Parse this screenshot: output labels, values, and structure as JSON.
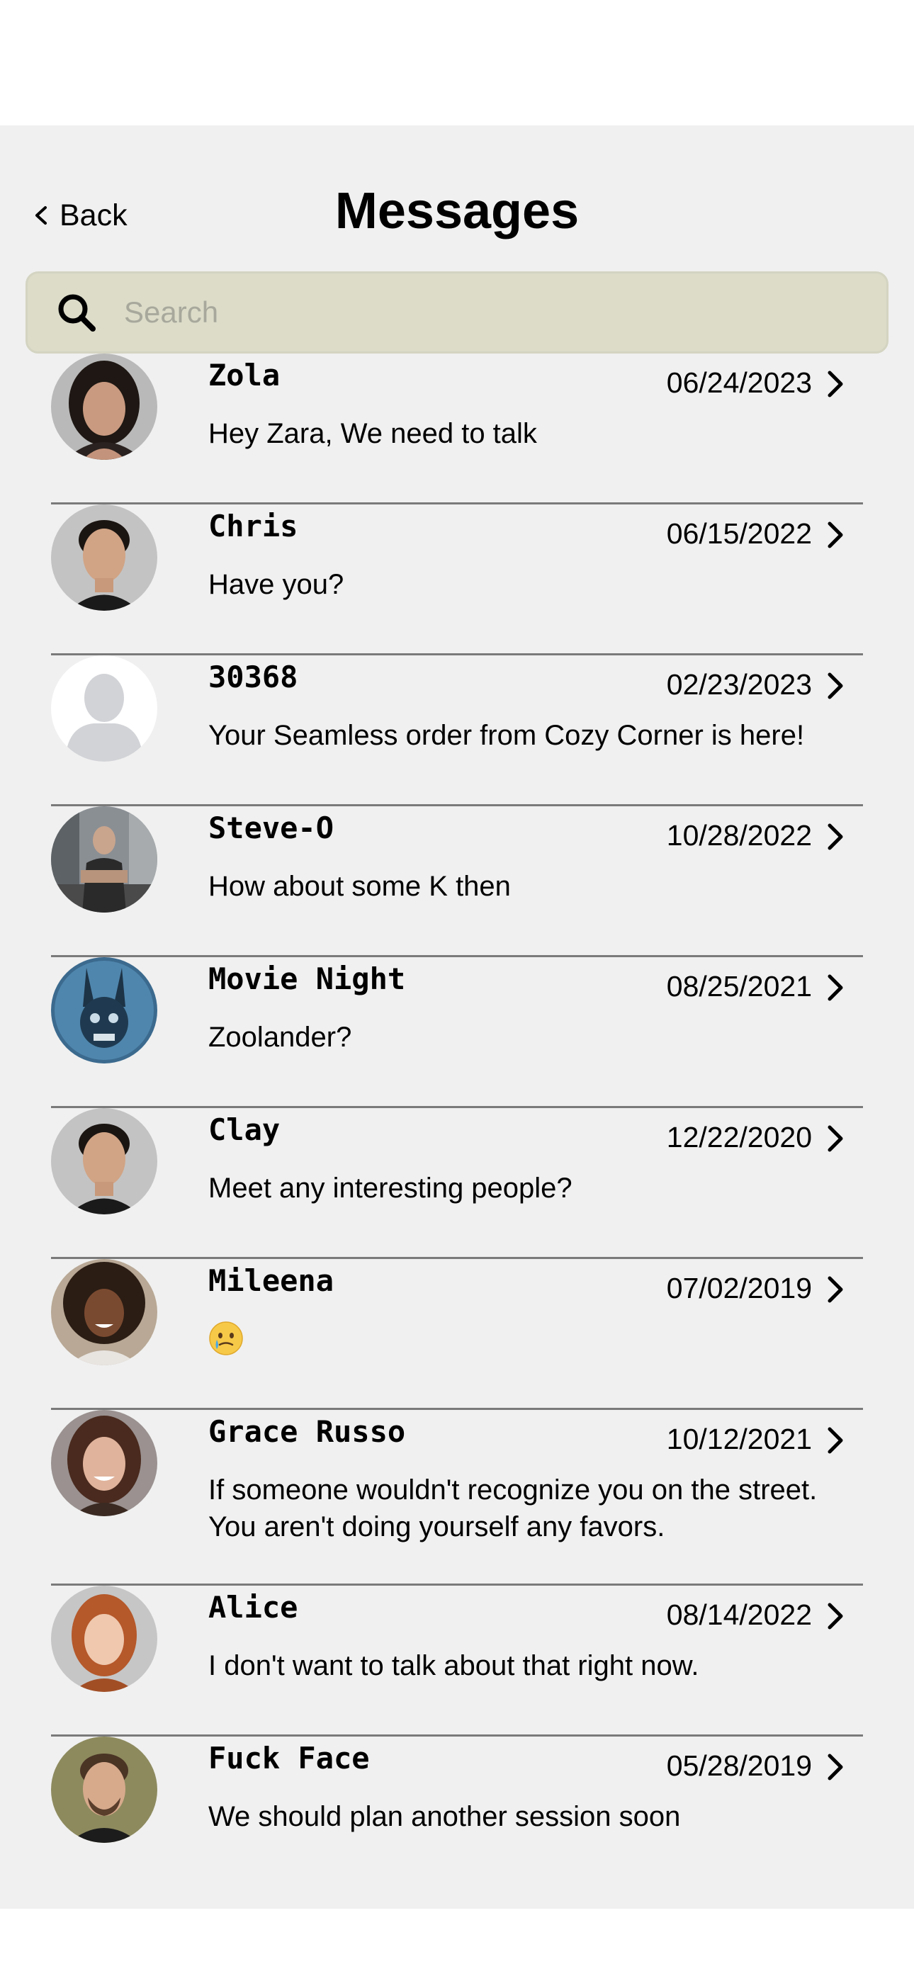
{
  "header": {
    "back_label": "Back",
    "title": "Messages"
  },
  "search": {
    "placeholder": "Search",
    "value": ""
  },
  "colors": {
    "background": "#f0f0f0",
    "search_background": "#dcdcc9",
    "divider": "#7a7a7a"
  },
  "conversations": [
    {
      "name": "Zola",
      "date": "06/24/2023",
      "preview": "Hey Zara, We need to talk",
      "avatar": "woman-dark-hair-photo"
    },
    {
      "name": "Chris",
      "date": "06/15/2022",
      "preview": "Have you?",
      "avatar": "man-photo"
    },
    {
      "name": "30368",
      "date": "02/23/2023",
      "preview": "Your Seamless order from Cozy Corner is here!",
      "avatar": "default-silhouette"
    },
    {
      "name": "Steve-O",
      "date": "10/28/2022",
      "preview": "How about some K then",
      "avatar": "man-street-photo"
    },
    {
      "name": "Movie Night",
      "date": "08/25/2021",
      "preview": "Zoolander?",
      "avatar": "rabbit-mask-photo"
    },
    {
      "name": "Clay",
      "date": "12/22/2020",
      "preview": "Meet any interesting people?",
      "avatar": "man-photo"
    },
    {
      "name": "Mileena",
      "date": "07/02/2019",
      "preview": "🥲",
      "avatar": "woman-curly-hair-photo"
    },
    {
      "name": "Grace Russo",
      "date": "10/12/2021",
      "preview": "If someone wouldn't recognize you on the street. You aren't doing yourself any favors.",
      "avatar": "woman-brunette-photo"
    },
    {
      "name": "Alice",
      "date": "08/14/2022",
      "preview": "I don't want to talk about that right now.",
      "avatar": "woman-redhead-photo"
    },
    {
      "name": "Fuck Face",
      "date": "05/28/2019",
      "preview": "We should plan another session soon",
      "avatar": "man-beard-photo"
    }
  ]
}
